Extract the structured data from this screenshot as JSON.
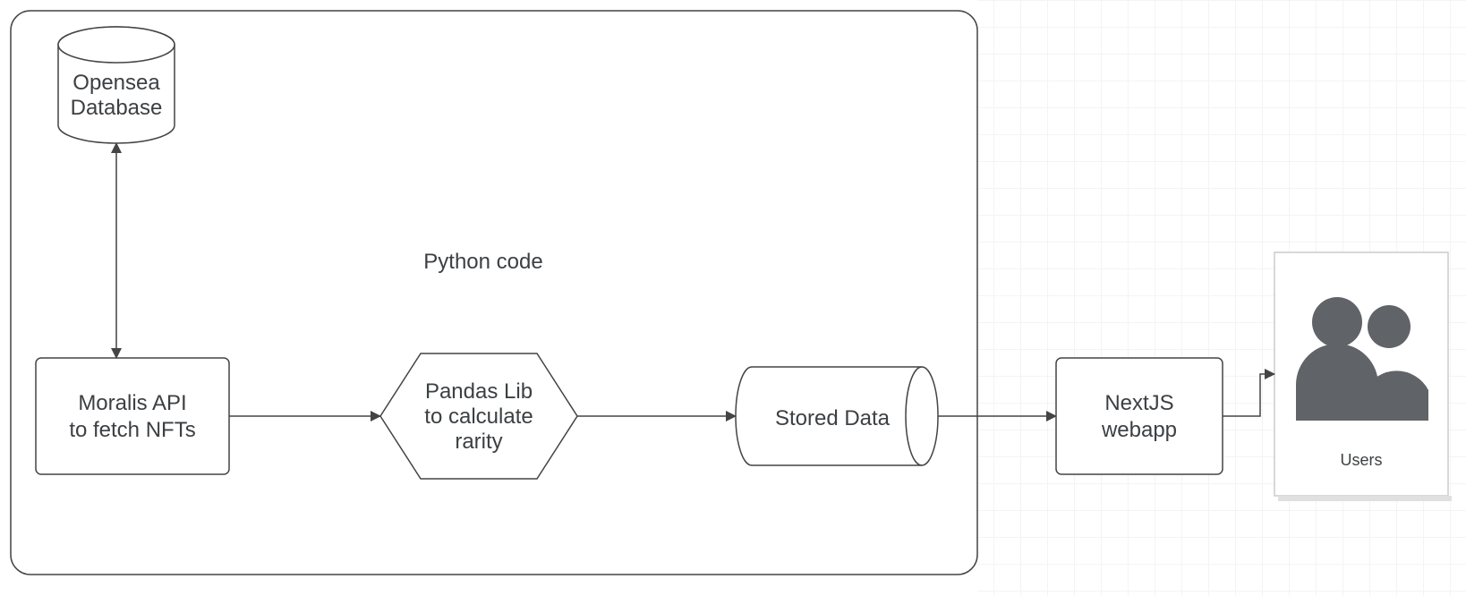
{
  "container": {
    "label": "Python code"
  },
  "nodes": {
    "opensea": {
      "line1": "Opensea",
      "line2": "Database"
    },
    "moralis": {
      "line1": "Moralis API",
      "line2": "to fetch NFTs"
    },
    "pandas": {
      "line1": "Pandas Lib",
      "line2": "to calculate",
      "line3": "rarity"
    },
    "stored": {
      "line1": "Stored Data"
    },
    "nextjs": {
      "line1": "NextJS",
      "line2": "webapp"
    },
    "users": {
      "line1": "Users"
    }
  }
}
